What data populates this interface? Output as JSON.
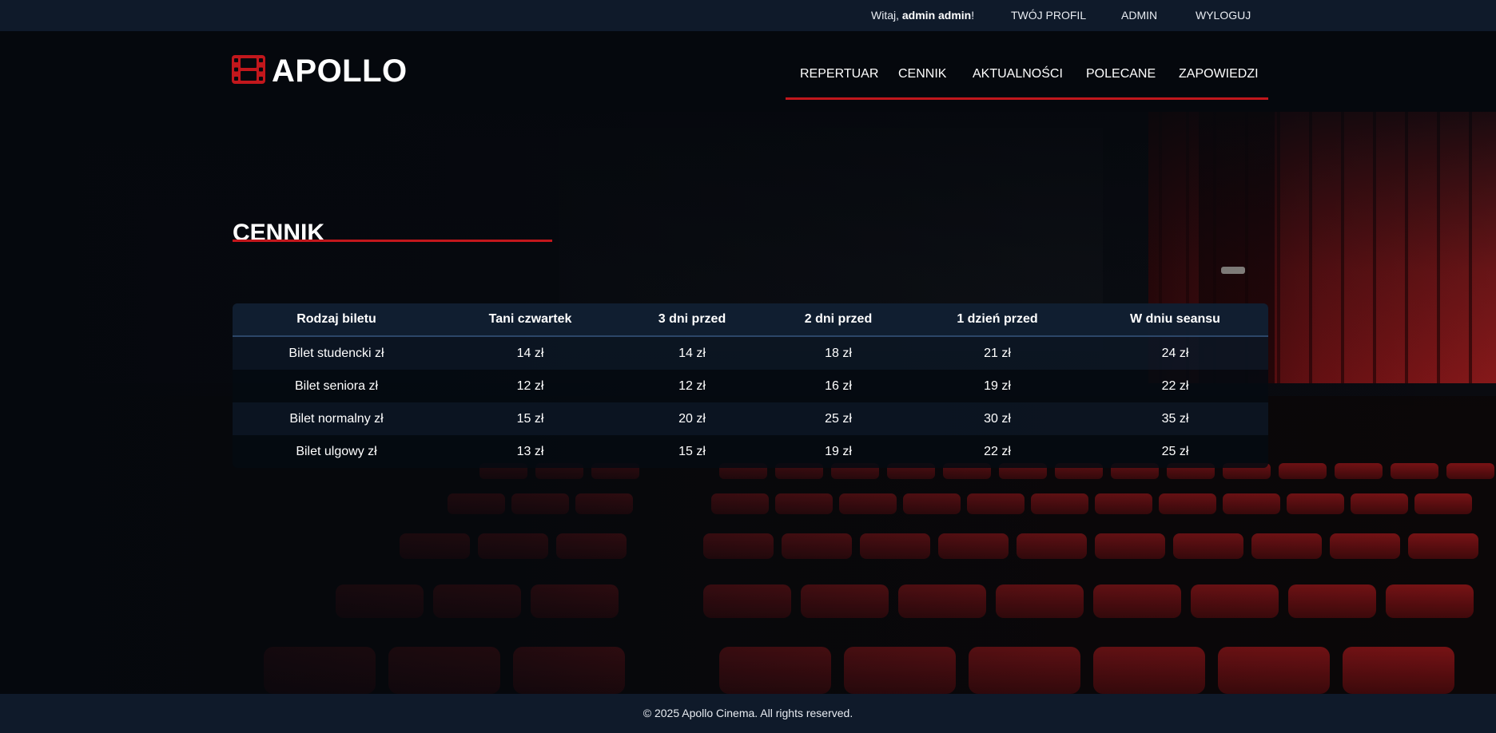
{
  "topbar": {
    "greeting_prefix": "Witaj, ",
    "greeting_user": "admin admin",
    "greeting_suffix": "!",
    "links": [
      "TWÓJ PROFIL",
      "ADMIN",
      "WYLOGUJ"
    ]
  },
  "header": {
    "logo_text": "APOLLO",
    "logo_icon": "film-icon",
    "nav": [
      "REPERTUAR",
      "CENNIK",
      "AKTUALNOŚCI",
      "POLECANE",
      "ZAPOWIEDZI"
    ]
  },
  "main": {
    "title": "CENNIK",
    "table": {
      "headers": [
        "Rodzaj biletu",
        "Tani czwartek",
        "3 dni przed",
        "2 dni przed",
        "1 dzień przed",
        "W dniu seansu"
      ],
      "rows": [
        [
          "Bilet studencki zł",
          "14 zł",
          "14 zł",
          "18 zł",
          "21 zł",
          "24 zł"
        ],
        [
          "Bilet seniora zł",
          "12 zł",
          "12 zł",
          "16 zł",
          "19 zł",
          "22 zł"
        ],
        [
          "Bilet normalny zł",
          "15 zł",
          "20 zł",
          "25 zł",
          "30 zł",
          "35 zł"
        ],
        [
          "Bilet ulgowy zł",
          "13 zł",
          "15 zł",
          "19 zł",
          "22 zł",
          "25 zł"
        ]
      ]
    }
  },
  "footer": {
    "copyright": "© 2025 Apollo Cinema. All rights reserved."
  },
  "colors": {
    "accent": "#c2171c",
    "bar_bg": "#0f1a2a",
    "header_bg": "#05080d"
  }
}
